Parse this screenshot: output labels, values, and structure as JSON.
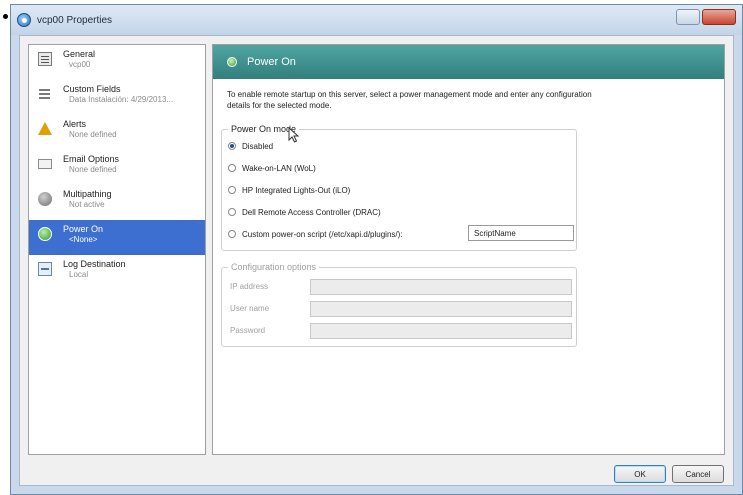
{
  "window": {
    "title": "vcp00 Properties"
  },
  "sidebar": {
    "items": [
      {
        "label": "General",
        "sub": "vcp00",
        "icon": "general-icon"
      },
      {
        "label": "Custom Fields",
        "sub": "Data Instalación: 4/29/2013...",
        "icon": "custom-fields-icon"
      },
      {
        "label": "Alerts",
        "sub": "None defined",
        "icon": "alert-icon"
      },
      {
        "label": "Email Options",
        "sub": "None defined",
        "icon": "email-icon"
      },
      {
        "label": "Multipathing",
        "sub": "Not active",
        "icon": "multipathing-icon"
      },
      {
        "label": "Power On",
        "sub": "<None>",
        "icon": "power-on-icon",
        "selected": true
      },
      {
        "label": "Log Destination",
        "sub": "Local",
        "icon": "log-destination-icon"
      }
    ]
  },
  "main": {
    "header": "Power On",
    "description": "To enable remote startup on this server, select a power management mode and enter any configuration details for the selected mode.",
    "power_mode": {
      "legend": "Power On mode",
      "options": [
        "Disabled",
        "Wake-on-LAN (WoL)",
        "HP Integrated Lights-Out (iLO)",
        "Dell Remote Access Controller (DRAC)",
        "Custom power-on script (/etc/xapi.d/plugins/):"
      ],
      "selected": "Disabled",
      "script_name": "ScriptName"
    },
    "config": {
      "legend": "Configuration options",
      "ip_label": "IP address",
      "user_label": "User name",
      "password_label": "Password"
    }
  },
  "buttons": {
    "ok": "OK",
    "cancel": "Cancel"
  },
  "colors": {
    "header_teal": "#3f908e",
    "selected_blue": "#3d6fd0"
  }
}
